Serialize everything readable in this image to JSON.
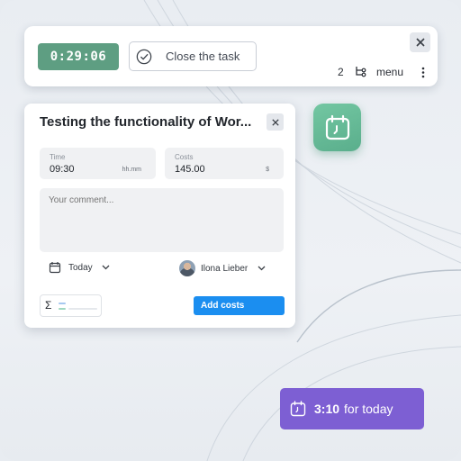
{
  "toolbar": {
    "timer": "0:29:06",
    "close_task_label": "Close the task",
    "count": "2",
    "menu_label": "menu"
  },
  "task": {
    "title": "Testing the functionality of Wor...",
    "time": {
      "label": "Time",
      "value": "09:30",
      "unit": "hh.mm"
    },
    "costs": {
      "label": "Costs",
      "value": "145.00",
      "unit": "$"
    },
    "comment_placeholder": "Your comment...",
    "date": "Today",
    "assignee": "Ilona Lieber",
    "sum_symbol": "Σ",
    "add_costs_label": "Add costs"
  },
  "today_badge": {
    "time": "3:10",
    "suffix": "for today"
  },
  "colors": {
    "timer_bg": "#5e9e82",
    "app_icon_bg": "#6bbd99",
    "primary_button": "#1b8ef0",
    "badge_bg": "#7d5fd3"
  },
  "icons": {
    "app": "calendar-clock-icon",
    "close": "close-icon",
    "check": "check-circle-icon",
    "branch": "branch-icon",
    "more": "more-vertical-icon",
    "date": "calendar-icon",
    "dropdown": "chevron-down-icon"
  }
}
